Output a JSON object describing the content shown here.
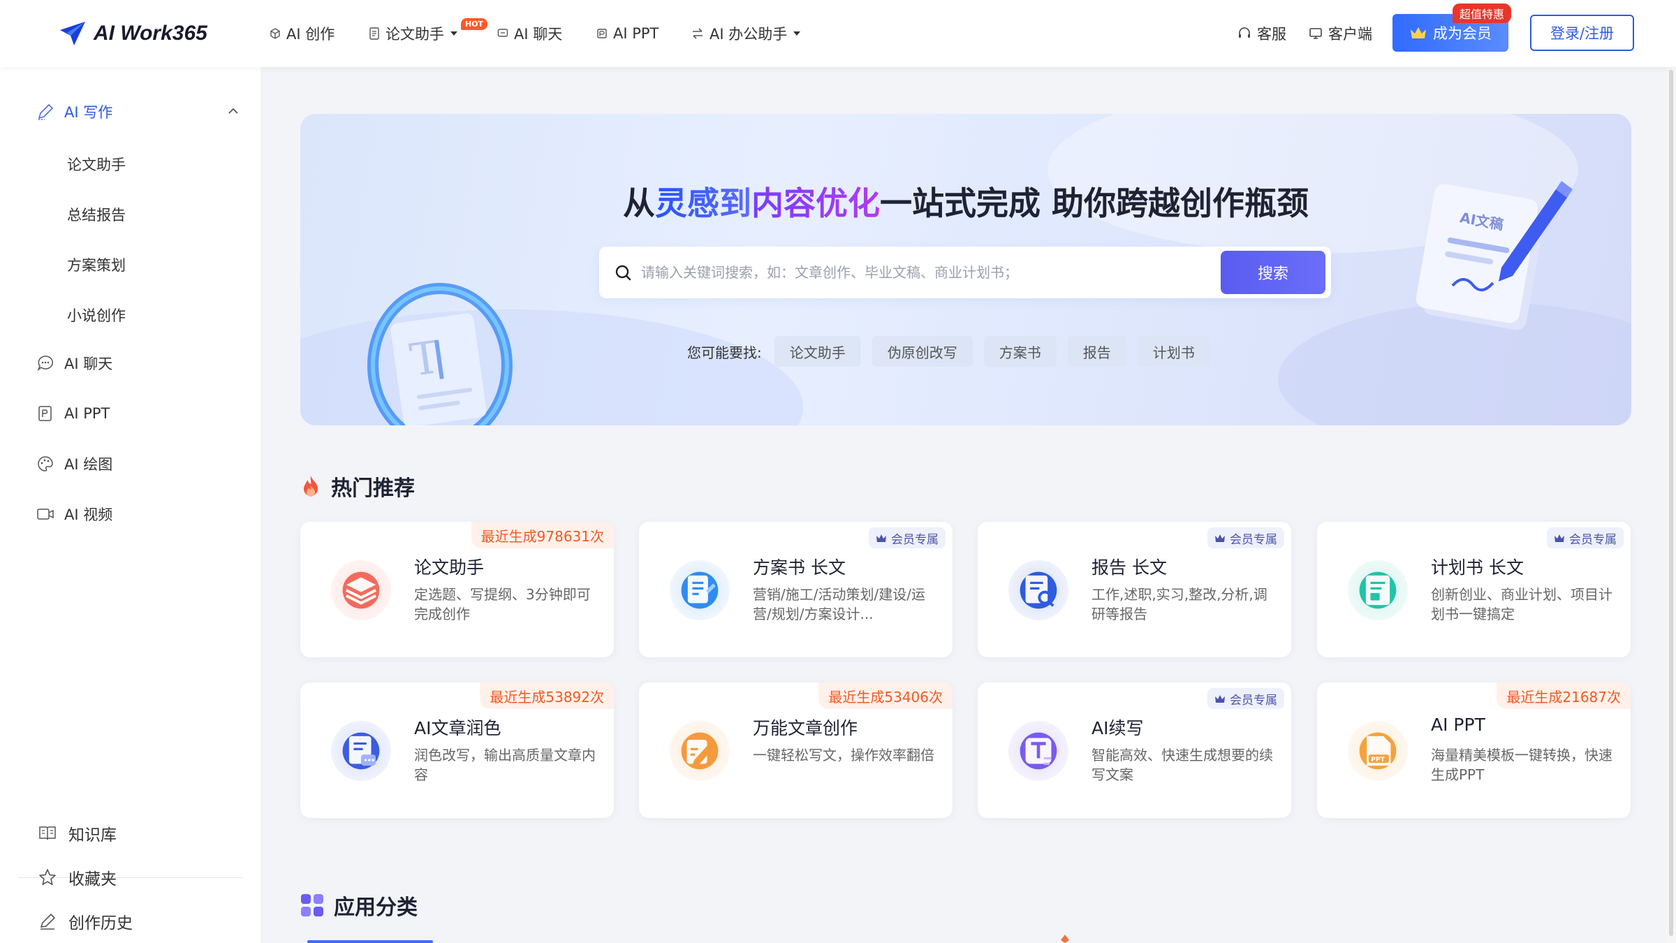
{
  "brand": {
    "name": "AI Work365"
  },
  "nav": {
    "items": [
      {
        "label": "AI 创作"
      },
      {
        "label": "论文助手",
        "badge": "HOT"
      },
      {
        "label": "AI 聊天"
      },
      {
        "label": "AI PPT"
      },
      {
        "label": "AI 办公助手"
      }
    ],
    "service": "客服",
    "client": "客户端",
    "vip_button": "成为会员",
    "vip_badge": "超值特惠",
    "login": "登录/注册"
  },
  "sidebar": {
    "section": {
      "label": "AI 写作",
      "expanded": true
    },
    "sub_items": [
      "论文助手",
      "总结报告",
      "方案策划",
      "小说创作"
    ],
    "items": [
      "AI 聊天",
      "AI PPT",
      "AI 绘图",
      "AI 视频"
    ],
    "bottom": [
      "知识库",
      "收藏夹",
      "创作历史"
    ]
  },
  "banner": {
    "title_parts": [
      "从",
      "灵感到",
      "内容优化",
      "一站式完成 助你跨越创作瓶颈"
    ],
    "search_placeholder": "请输入关键词搜索，如：文章创作、毕业文稿、商业计划书；",
    "search_button": "搜索",
    "suggest_label": "您可能要找:",
    "suggestions": [
      "论文助手",
      "伪原创改写",
      "方案书",
      "报告",
      "计划书"
    ],
    "illustration_text": "AI文稿"
  },
  "hot": {
    "title": "热门推荐",
    "cards": [
      {
        "title": "论文助手",
        "desc": "定选题、写提纲、3分钟即可完成创作",
        "tag": "最近生成978631次",
        "icon": "layers-icon",
        "color": "#f36b5c"
      },
      {
        "title": "方案书 长文",
        "desc": "营销/施工/活动策划/建设/运营/规划/方案设计...",
        "tag": "会员专属",
        "icon": "doc-edit-icon",
        "color": "#2f8cf0"
      },
      {
        "title": "报告 长文",
        "desc": "工作,述职,实习,整改,分析,调研等报告",
        "tag": "会员专属",
        "icon": "report-search-icon",
        "color": "#2f5be0"
      },
      {
        "title": "计划书 长文",
        "desc": "创新创业、商业计划、项目计划书一键搞定",
        "tag": "会员专属",
        "icon": "plan-doc-icon",
        "color": "#22c3a6"
      },
      {
        "title": "AI文章润色",
        "desc": "润色改写，输出高质量文章内容",
        "tag": "最近生成53892次",
        "icon": "polish-doc-icon",
        "color": "#3b5de0"
      },
      {
        "title": "万能文章创作",
        "desc": "一键轻松写文，操作效率翻倍",
        "tag": "最近生成53406次",
        "icon": "pen-write-icon",
        "color": "#f59a3c"
      },
      {
        "title": "AI续写",
        "desc": "智能高效、快速生成想要的续写文案",
        "tag": "会员专属",
        "icon": "text-continue-icon",
        "color": "#7a5af0"
      },
      {
        "title": "AI PPT",
        "desc": "海量精美模板一键转换，快速生成PPT",
        "tag": "最近生成21687次",
        "icon": "ppt-file-icon",
        "color": "#f5a23c"
      }
    ]
  },
  "categories": {
    "title": "应用分类"
  }
}
